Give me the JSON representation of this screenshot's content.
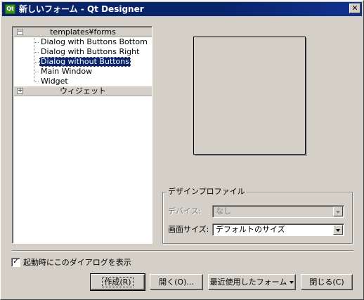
{
  "window": {
    "title": "新しいフォーム - Qt Designer",
    "icon": "qt-designer-app-icon",
    "icon_text": "Qt",
    "close_label": "✕"
  },
  "tree": {
    "category_templates": "templates¥forms",
    "templates_expander": "−",
    "items": [
      "Dialog with Buttons Bottom",
      "Dialog with Buttons Right",
      "Dialog without Buttons",
      "Main Window",
      "Widget"
    ],
    "selected_index": 2,
    "category_widgets": "ウィジェット",
    "widgets_expander": "+"
  },
  "design_profile": {
    "title": "デザインプロファイル",
    "device_label": "デバイス:",
    "device_value": "なし",
    "screen_size_label": "画面サイズ:",
    "screen_size_value": "デフォルトのサイズ"
  },
  "footer": {
    "show_on_startup_label": "起動時にこのダイアログを表示",
    "show_on_startup_checked": true,
    "check_mark": "✓",
    "create_label": "作成(R)",
    "open_label": "開く(O)...",
    "recent_label": "最近使用したフォーム",
    "close_label": "閉じる(C)"
  },
  "colors": {
    "titlebar": "#0a246a",
    "window_bg": "#d4d0c8",
    "selection": "#0a246a"
  }
}
